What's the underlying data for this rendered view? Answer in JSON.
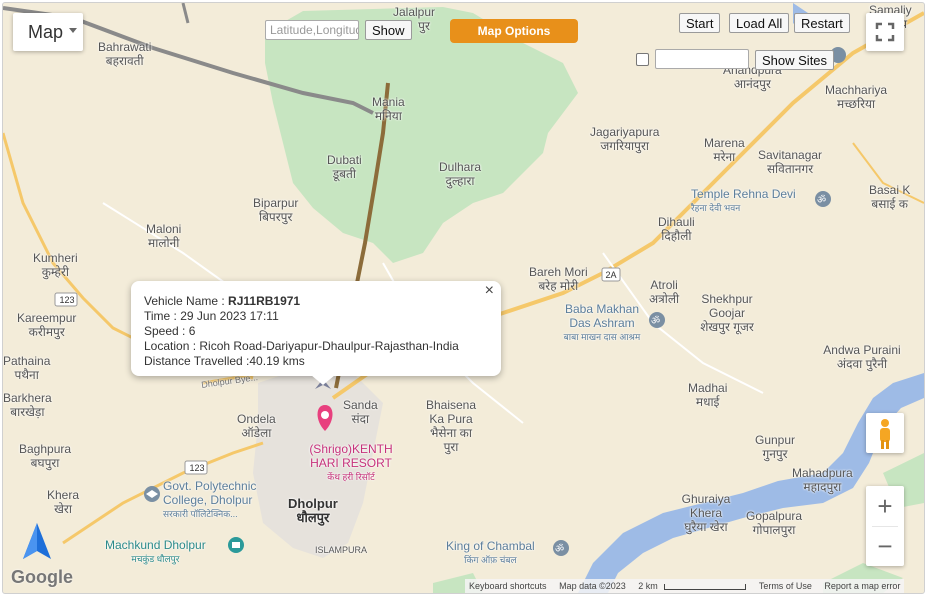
{
  "map_type_label": "Map",
  "latlng_placeholder": "Latitude,Longitude",
  "show_label": "Show",
  "map_options_label": "Map Options",
  "start_label": "Start",
  "load_all_label": "Load All",
  "restart_label": "Restart",
  "show_sites_label": "Show Sites",
  "zoom_in_label": "+",
  "zoom_out_label": "−",
  "accent": "#e8901a",
  "popup": {
    "vehicle_label": "Vehicle Name : ",
    "vehicle_value": "RJ11RB1971",
    "time": "Time : 29 Jun 2023 17:11",
    "speed": "Speed : 6",
    "location": "Location : Ricoh Road-Dariyapur-Dhaulpur-Rajasthan-India",
    "distance": "Distance Travelled :40.19 kms",
    "close": "×"
  },
  "places": [
    {
      "en": "Jalalpur",
      "hi": "पुर"
    },
    {
      "en": "Bahrawati",
      "hi": "बहरावती"
    },
    {
      "en": "Mania",
      "hi": "मनिया"
    },
    {
      "en": "Dubati",
      "hi": "डूबती"
    },
    {
      "en": "Dulhara",
      "hi": "दुल्हारा"
    },
    {
      "en": "Biparpur",
      "hi": "बिपरपुर"
    },
    {
      "en": "Maloni",
      "hi": "मालोनी"
    },
    {
      "en": "Kumheri",
      "hi": "कुम्हेरी"
    },
    {
      "en": "Kareempur",
      "hi": "करीमपुर"
    },
    {
      "en": "Pathaina",
      "hi": "पथैना"
    },
    {
      "en": "Barkhera",
      "hi": "बारखेड़ा"
    },
    {
      "en": "Baghpura",
      "hi": "बघपुरा"
    },
    {
      "en": "Khera",
      "hi": "खेरा"
    },
    {
      "en": "Ondela",
      "hi": "ऑडेला"
    },
    {
      "en": "Sanda",
      "hi": "संदा"
    },
    {
      "en": "Bhaisena Ka Pura",
      "hi": "भैसेना का पुरा"
    },
    {
      "en": "Dholpur",
      "hi": "धौलपुर"
    },
    {
      "en": "Jagariyapura",
      "hi": "जगरियापुरा"
    },
    {
      "en": "Marena",
      "hi": "मरेना"
    },
    {
      "en": "Savitanagar",
      "hi": "सवितानगर"
    },
    {
      "en": "Dihauli",
      "hi": "दिहौली"
    },
    {
      "en": "Bareh Mori",
      "hi": "बरेह मोरी"
    },
    {
      "en": "Atroli",
      "hi": "अत्रोली"
    },
    {
      "en": "Shekhpur Goojar",
      "hi": "शेखपुर गूजर"
    },
    {
      "en": "Andwa Puraini",
      "hi": "अंदवा पुरैनी"
    },
    {
      "en": "Madhai",
      "hi": "मधाई"
    },
    {
      "en": "Gunpur",
      "hi": "गुनपुर"
    },
    {
      "en": "Mahadpura",
      "hi": "महादपुरा"
    },
    {
      "en": "Ghuraiya Khera",
      "hi": "घुरैया खेरा"
    },
    {
      "en": "Gopalpura",
      "hi": "गोपालपुरा"
    },
    {
      "en": "Anandpura",
      "hi": "आनंदपुर"
    },
    {
      "en": "Machhariya",
      "hi": "मच्छरिया"
    },
    {
      "en": "Basai K",
      "hi": "बसाई क"
    },
    {
      "en": "Samaliy",
      "hi": "समलिय"
    }
  ],
  "pois": [
    {
      "en": "Temple Rehna Devi",
      "hi": "रैहना देवी भवन"
    },
    {
      "en": "Baba Makhan Das Ashram",
      "hi": "बाबा माखन दास आश्रम"
    },
    {
      "en": "(Shrigo)KENTH HARI RESORT",
      "hi": "केंथ हरी रिसॉर्ट"
    },
    {
      "en": "Govt. Polytechnic College, Dholpur",
      "hi": "सरकारी पॉलिटेक्निक..."
    },
    {
      "en": "Machkund Dholpur",
      "hi": "मचकुंड धौलपुर"
    },
    {
      "en": "King of Chambal",
      "hi": "किंग ऑफ़ चंबल"
    }
  ],
  "road_labels": [
    "123",
    "123",
    "2A",
    "Dholpur Bye..."
  ],
  "islampura": "ISLAMPURA",
  "attribution": {
    "keyboard": "Keyboard shortcuts",
    "mapdata": "Map data ©2023",
    "scale": "2 km",
    "terms": "Terms of Use",
    "report": "Report a map error"
  },
  "google": "Google"
}
